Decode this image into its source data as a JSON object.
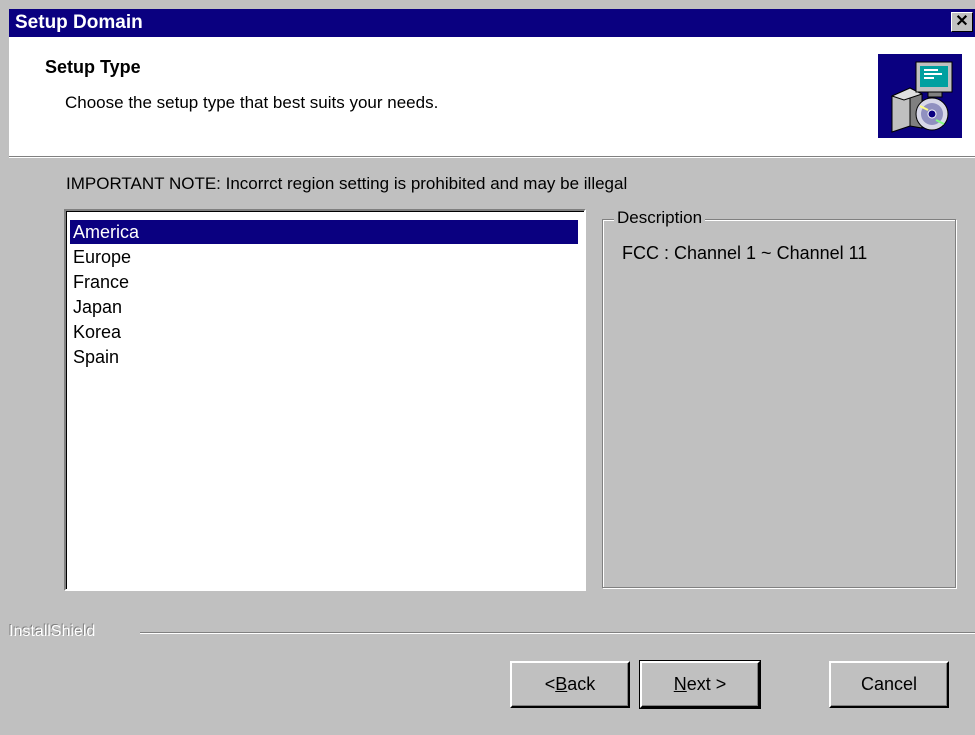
{
  "window": {
    "title": "Setup Domain",
    "close_icon": "close-icon"
  },
  "header": {
    "title": "Setup Type",
    "subtitle": "Choose the setup type that best suits your needs.",
    "icon": "setup-install-icon"
  },
  "note": "IMPORTANT NOTE: Incorrct region setting is prohibited and may be illegal",
  "regions": {
    "selected": "America",
    "items": [
      "America",
      "Europe",
      "France",
      "Japan",
      "Korea",
      "Spain"
    ]
  },
  "description": {
    "label": "Description",
    "text": "FCC : Channel 1 ~ Channel 11"
  },
  "brand": "InstallShield",
  "buttons": {
    "back": {
      "prefix": "< ",
      "accel": "B",
      "rest": "ack"
    },
    "next": {
      "accel": "N",
      "rest": "ext >"
    },
    "cancel": "Cancel"
  },
  "colors": {
    "titlebar": "#0a0080",
    "face": "#c0c0c0",
    "selection": "#0a0080"
  }
}
